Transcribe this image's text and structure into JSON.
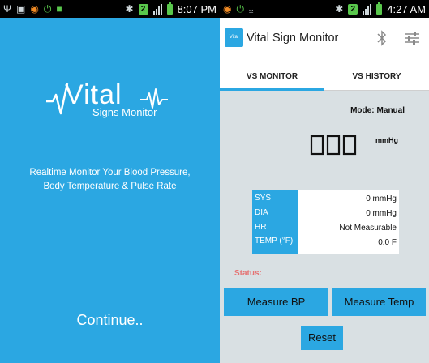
{
  "left_screen": {
    "status_bar": {
      "time": "8:07 PM"
    },
    "logo": {
      "word": "Vital",
      "subtitle": "Signs Monitor"
    },
    "tagline": {
      "line1": "Realtime Monitor Your Blood Pressure,",
      "line2": "Body Temperature & Pulse Rate"
    },
    "continue_label": "Continue.."
  },
  "right_screen": {
    "status_bar": {
      "time": "4:27 AM"
    },
    "app_bar": {
      "icon_text": "Vital",
      "title": "Vital Sign Monitor"
    },
    "tabs": [
      {
        "label": "VS MONITOR",
        "active": true
      },
      {
        "label": "VS HISTORY",
        "active": false
      }
    ],
    "mode": {
      "label": "Mode:",
      "value": "Manual"
    },
    "display": {
      "value": "000",
      "unit": "mmHg"
    },
    "readings": [
      {
        "label": "SYS",
        "value": "0 mmHg"
      },
      {
        "label": "DIA",
        "value": "0 mmHg"
      },
      {
        "label": "HR",
        "value": "Not Measurable"
      },
      {
        "label": "TEMP (°F)",
        "value": "0.0 F"
      }
    ],
    "status_label": "Status:",
    "buttons": {
      "measure_bp": "Measure BP",
      "measure_temp": "Measure Temp",
      "reset": "Reset"
    }
  },
  "colors": {
    "accent": "#2ba7e2",
    "panel_background": "#d9e0e3",
    "status_label": "#e57373",
    "status_bar": "#000000"
  },
  "icons": [
    "usb-icon",
    "image-icon",
    "record-icon",
    "power-icon",
    "android-icon",
    "bluetooth-icon",
    "data-badge-icon",
    "signal-icon",
    "battery-icon",
    "download-icon",
    "settings-sliders-icon",
    "heartbeat-icon"
  ]
}
